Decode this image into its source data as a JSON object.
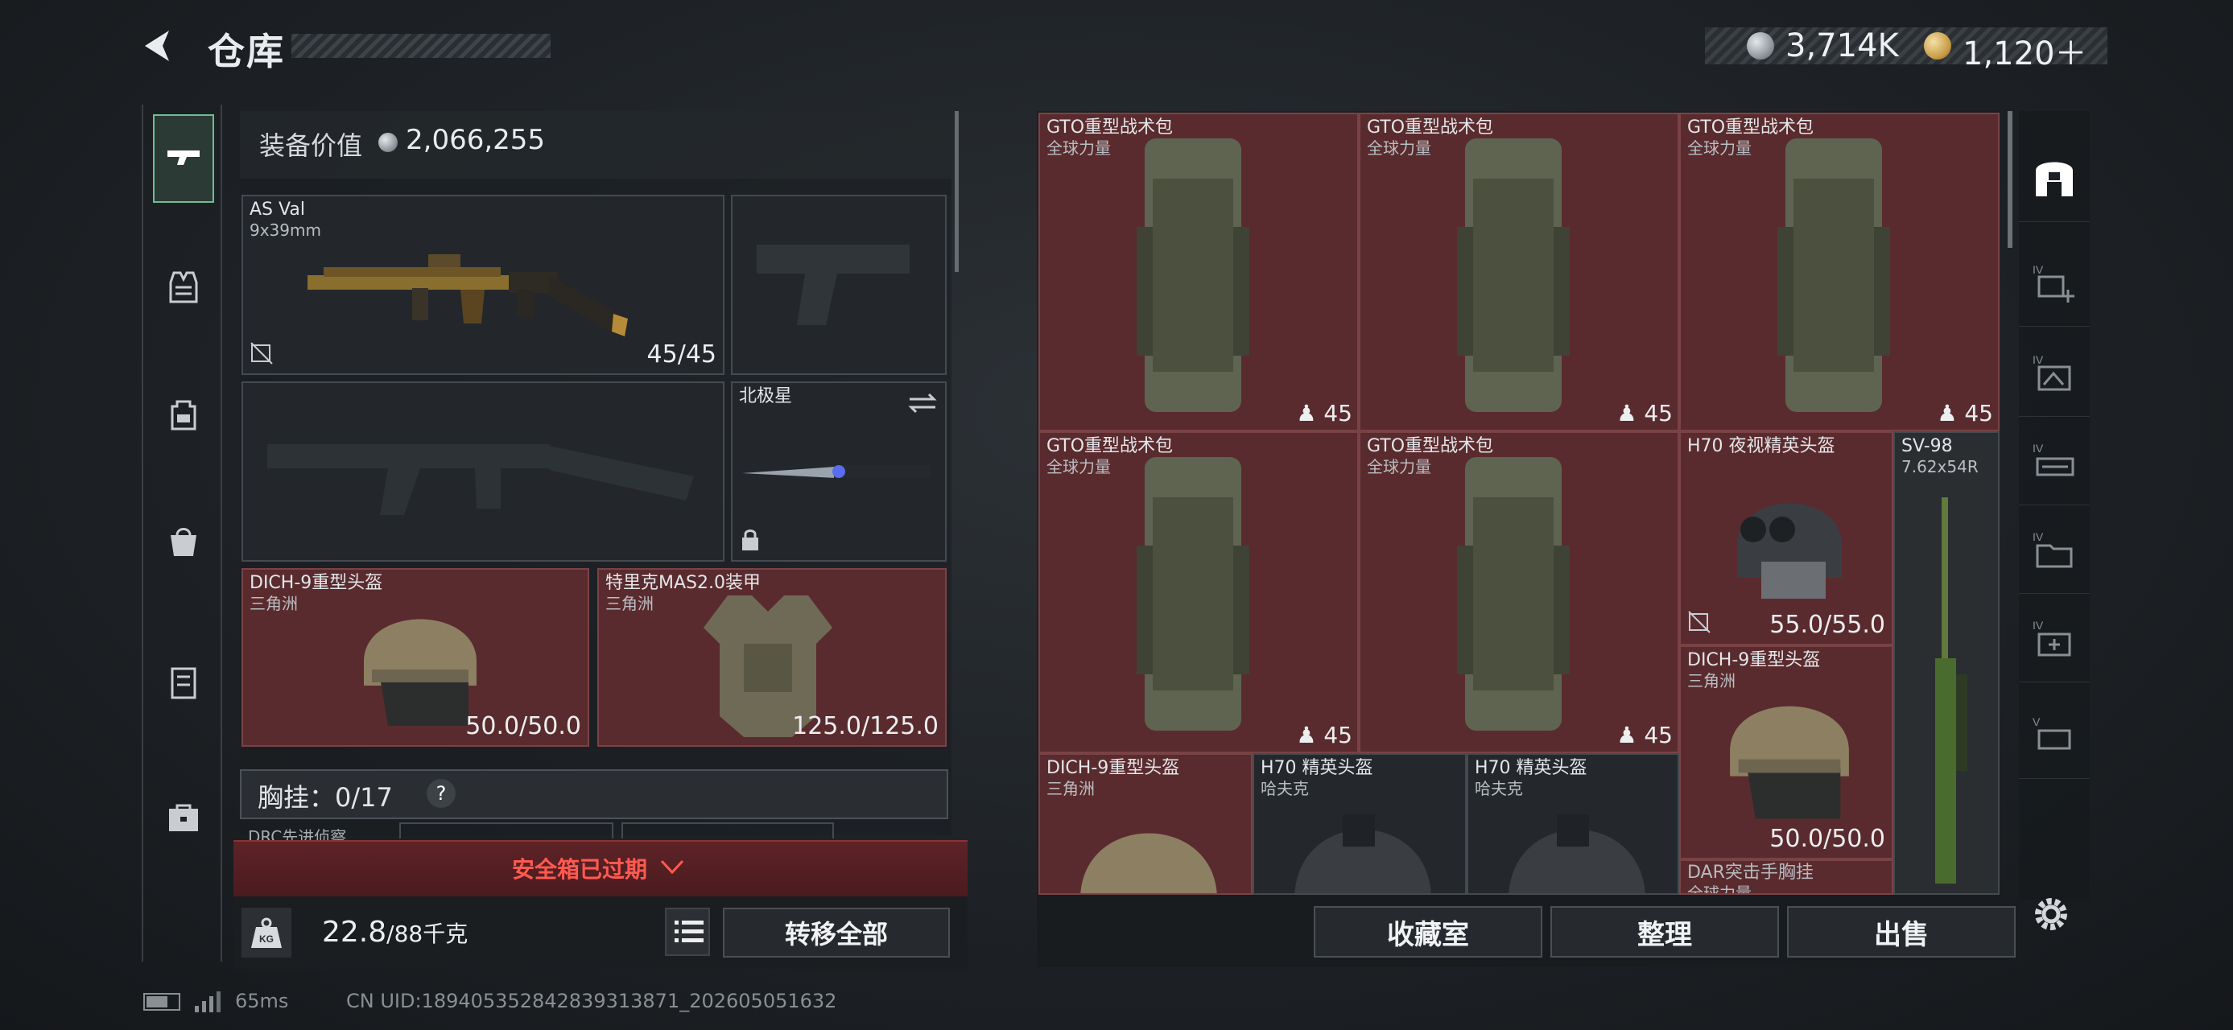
{
  "header": {
    "title": "仓库",
    "currency1": "3,714K",
    "currency2": "1,120＋"
  },
  "left_nav": {
    "items": [
      "gun-icon",
      "vest-icon",
      "backpack-icon",
      "pouch-icon",
      "case-icon",
      "toolbox-icon"
    ]
  },
  "loadout": {
    "value_label": "装备价值",
    "value": "2,066,255",
    "primary": {
      "name": "AS Val",
      "caliber": "9x39mm",
      "ammo": "45/45"
    },
    "melee": {
      "name": "北极星"
    },
    "helmet": {
      "name": "DICH-9重型头盔",
      "source": "三角洲",
      "durability": "50.0/50.0"
    },
    "armor": {
      "name": "特里克MAS2.0装甲",
      "source": "三角洲",
      "durability": "125.0/125.0"
    },
    "chest_rig": {
      "label": "胸挂：",
      "count": "0/17",
      "help": "?",
      "sub": "DRC先进侦察"
    },
    "safebox": "安全箱已过期",
    "weight_value": "22.8",
    "weight_unit": "/88千克",
    "transfer_all": "转移全部"
  },
  "inventory": {
    "items": [
      {
        "name": "GTO重型战术包",
        "source": "全球力量",
        "count": "45"
      },
      {
        "name": "GTO重型战术包",
        "source": "全球力量",
        "count": "45"
      },
      {
        "name": "GTO重型战术包",
        "source": "全球力量",
        "count": "45"
      },
      {
        "name": "GTO重型战术包",
        "source": "全球力量",
        "count": "45"
      },
      {
        "name": "GTO重型战术包",
        "source": "全球力量",
        "count": "45"
      },
      {
        "name": "H70 夜视精英头盔",
        "source": "",
        "durability": "55.0/55.0"
      },
      {
        "name": "SV-98",
        "source": "7.62x54R"
      },
      {
        "name": "DICH-9重型头盔",
        "source": "三角洲",
        "durability": "50.0/50.0"
      },
      {
        "name": "DICH-9重型头盔",
        "source": "三角洲"
      },
      {
        "name": "H70 精英头盔",
        "source": "哈夫克"
      },
      {
        "name": "H70 精英头盔",
        "source": "哈夫克"
      },
      {
        "name": "DAR突击手胸挂",
        "source": "全球力量"
      }
    ],
    "buttons": {
      "vault": "收藏室",
      "sort": "整理",
      "sell": "出售"
    }
  },
  "status": {
    "ping": "65ms",
    "uid": "CN UID:1894053528428393138​71_202605051632"
  },
  "colors": {
    "accent": "#6bbf95",
    "item_red": "#5a2b2e",
    "warning": "#ff5a50"
  }
}
